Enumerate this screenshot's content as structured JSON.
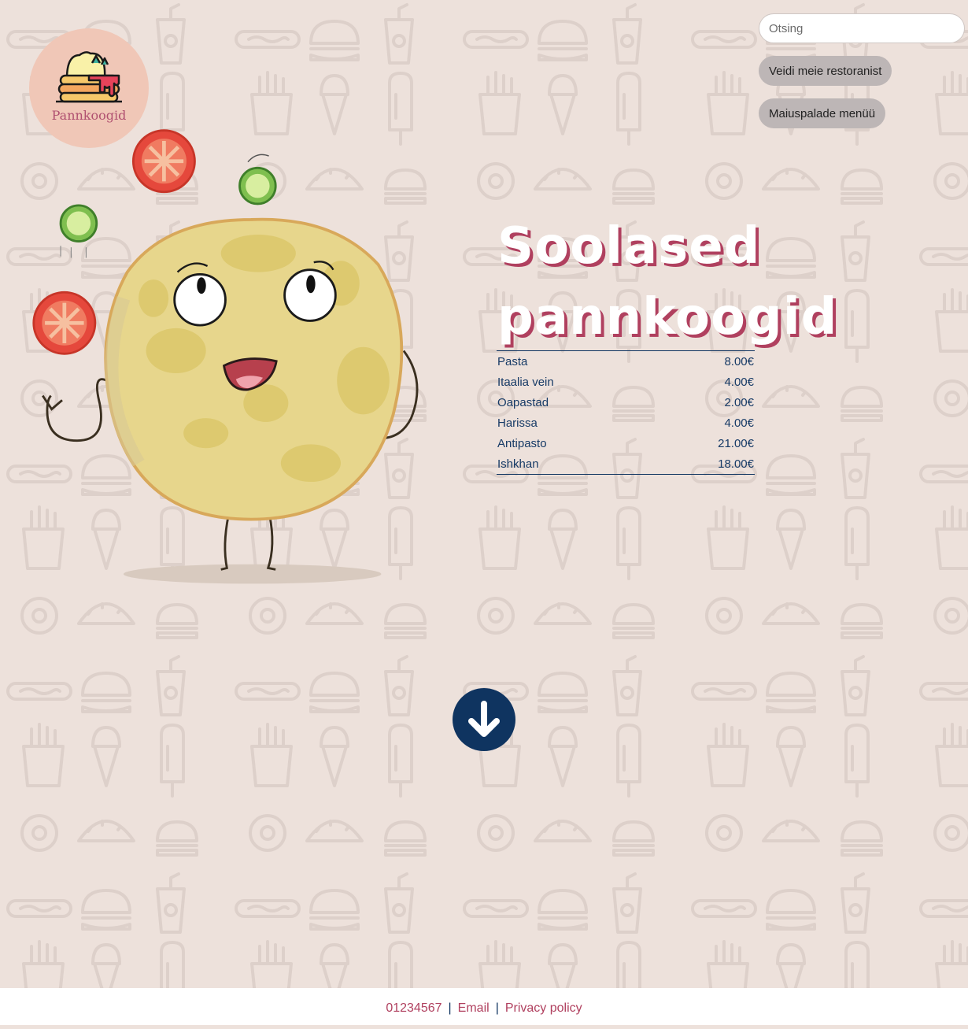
{
  "header": {
    "logo_text": "Pannkoogid",
    "search": {
      "placeholder": "Otsing"
    },
    "nav": [
      {
        "label": "Veidi meie restoranist"
      },
      {
        "label": "Maiuspalade menüü"
      }
    ]
  },
  "main": {
    "title_line1": "Soolased",
    "title_line2": "pannkoogid",
    "menu": [
      {
        "name": "Pasta",
        "price": "8.00€"
      },
      {
        "name": "Itaalia vein",
        "price": "4.00€"
      },
      {
        "name": "Oapastad",
        "price": "2.00€"
      },
      {
        "name": "Harissa",
        "price": "4.00€"
      },
      {
        "name": "Antipasto",
        "price": "21.00€"
      },
      {
        "name": "Ishkhan",
        "price": "18.00€"
      }
    ],
    "scroll_icon": "arrow-down-icon"
  },
  "footer": {
    "phone": "01234567",
    "email_label": "Email",
    "privacy_label": "Privacy policy",
    "separator": "|"
  },
  "colors": {
    "background": "#ede1db",
    "accent": "#b0405f",
    "navy": "#0f3460",
    "logo_circle": "#f0c7b7",
    "nav_button": "#bdb6b6"
  }
}
